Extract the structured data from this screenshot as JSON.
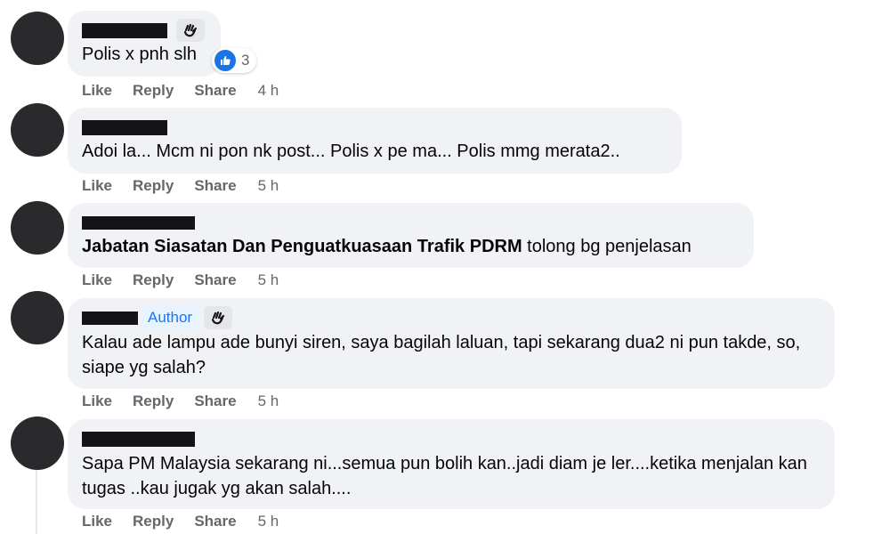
{
  "colors": {
    "bubble_bg": "#f0f2f5",
    "action_text": "#65676b",
    "author_badge_bg": "#e7f3ff",
    "author_badge_text": "#1877f2",
    "like_blue": "#1b74e4",
    "redaction": "#141416"
  },
  "comments": [
    {
      "name_redacted": true,
      "badge_icon": "waving-hand-icon",
      "text": "Polis x pnh slh",
      "reaction": {
        "icon": "like-icon",
        "count": "3"
      },
      "actions": {
        "like": "Like",
        "reply": "Reply",
        "share": "Share",
        "time": "4 h"
      }
    },
    {
      "name_redacted": true,
      "text": "Adoi la... Mcm ni pon nk post... Polis x pe ma... Polis mmg merata2..",
      "actions": {
        "like": "Like",
        "reply": "Reply",
        "share": "Share",
        "time": "5 h"
      }
    },
    {
      "name_redacted": true,
      "mention": "Jabatan Siasatan Dan Penguatkuasaan Trafik PDRM",
      "text": " tolong bg penjelasan",
      "actions": {
        "like": "Like",
        "reply": "Reply",
        "share": "Share",
        "time": "5 h"
      }
    },
    {
      "name_redacted": true,
      "author_label": "Author",
      "badge_icon": "waving-hand-icon",
      "text": "Kalau ade lampu ade bunyi siren, saya bagilah laluan, tapi sekarang dua2 ni pun takde, so, siape yg salah?",
      "actions": {
        "like": "Like",
        "reply": "Reply",
        "share": "Share",
        "time": "5 h"
      }
    },
    {
      "name_redacted": true,
      "text": "Sapa PM Malaysia sekarang ni...semua pun bolih kan..jadi diam je ler....ketika menjalan kan tugas ..kau jugak yg akan salah....",
      "actions": {
        "like": "Like",
        "reply": "Reply",
        "share": "Share",
        "time": "5 h"
      }
    }
  ]
}
